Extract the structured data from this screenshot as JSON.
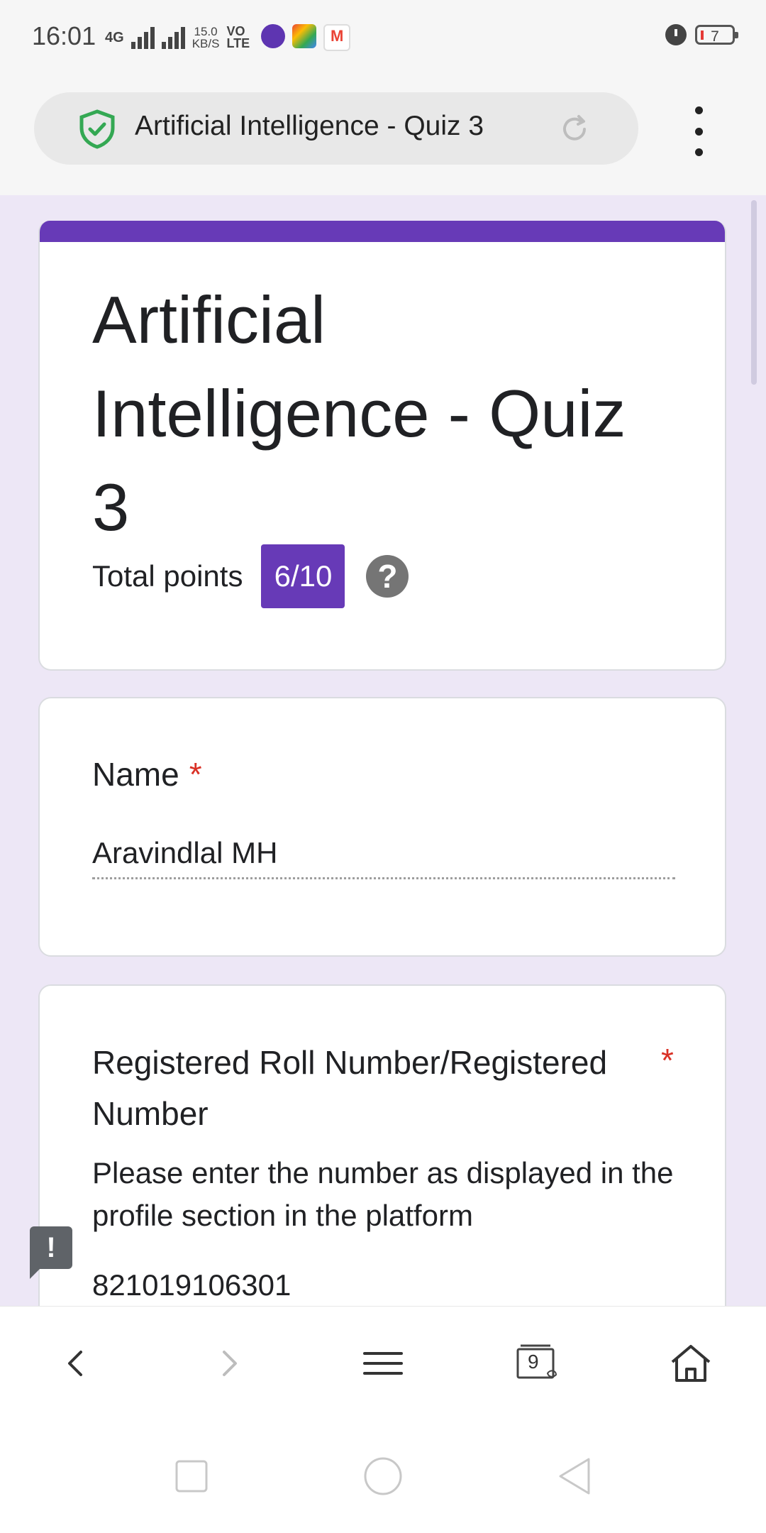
{
  "status_bar": {
    "time": "16:01",
    "network_type": "4G",
    "speed_value": "15.0",
    "speed_unit": "KB/S",
    "volte_top": "VO",
    "volte_bottom": "LTE",
    "battery_level": "7",
    "app_icons": [
      "mail-app-icon",
      "puzzle-app-icon",
      "gmail-app-icon"
    ]
  },
  "browser": {
    "url_title": "Artificial Intelligence - Quiz 3",
    "secure_icon": "shield-check-icon",
    "reload_icon": "reload-icon",
    "menu_icon": "more-vert-icon"
  },
  "form": {
    "accent_color": "#673ab7",
    "title": "Artificial Intelligence - Quiz 3",
    "total_points_label": "Total points",
    "score": "6/10",
    "help_symbol": "?",
    "questions": [
      {
        "label": "Name",
        "required_mark": "*",
        "answer": "Aravindlal MH"
      },
      {
        "label": "Registered Roll Number/Registered Number",
        "required_mark": "*",
        "description": "Please enter the number as displayed in the profile section in the platform",
        "answer": "821019106301"
      }
    ],
    "feedback_symbol": "!"
  },
  "browser_nav": {
    "tabs_count": "9",
    "icons": [
      "back-arrow-icon",
      "forward-arrow-icon",
      "menu-lines-icon",
      "tabs-icon",
      "home-icon"
    ]
  },
  "system_nav": {
    "icons": [
      "recents-square-icon",
      "home-circle-icon",
      "back-triangle-icon"
    ]
  }
}
